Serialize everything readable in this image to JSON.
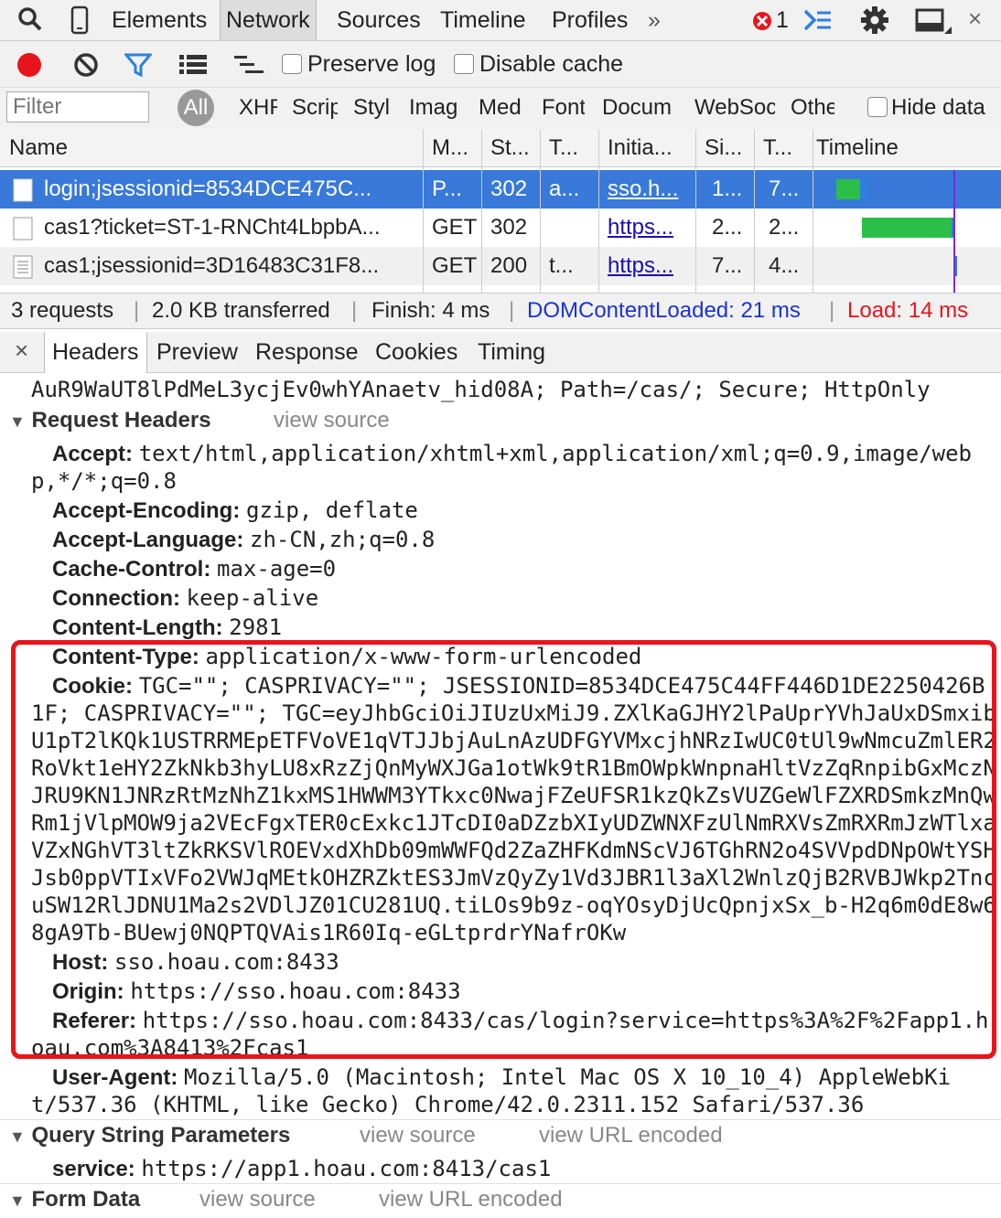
{
  "toolbar": {
    "tabs": [
      "Elements",
      "Network",
      "Sources",
      "Timeline",
      "Profiles"
    ],
    "more": "»",
    "error_count": "1"
  },
  "controls": {
    "preserve_log": "Preserve log",
    "disable_cache": "Disable cache"
  },
  "filter": {
    "placeholder": "Filter",
    "types": [
      "All",
      "XHR",
      "Scrip",
      "Styl",
      "Imag",
      "Med",
      "Font",
      "Docum",
      "WebSoc",
      "Othe"
    ],
    "hide_data": "Hide data"
  },
  "grid": {
    "headers": [
      "Name",
      "M...",
      "St...",
      "T...",
      "Initia...",
      "Si...",
      "T...",
      "Timeline"
    ],
    "rows": [
      {
        "name": "login;jsessionid=8534DCE475C...",
        "method": "P...",
        "status": "302",
        "type": "a...",
        "initiator": "sso.h...",
        "size": "1...",
        "time": "7..."
      },
      {
        "name": "cas1?ticket=ST-1-RNCht4LbpbA...",
        "method": "GET",
        "status": "302",
        "type": "",
        "initiator": "https...",
        "size": "2...",
        "time": "2..."
      },
      {
        "name": "cas1;jsessionid=3D16483C31F8...",
        "method": "GET",
        "status": "200",
        "type": "t...",
        "initiator": "https...",
        "size": "7...",
        "time": "4..."
      }
    ]
  },
  "summary": {
    "requests": "3 requests",
    "transferred": "2.0 KB transferred",
    "finish": "Finish: 4 ms",
    "dcl": "DOMContentLoaded: 21 ms",
    "load": "Load: 14 ms",
    "sep": "|"
  },
  "detail_tabs": [
    "Headers",
    "Preview",
    "Response",
    "Cookies",
    "Timing"
  ],
  "close": "×",
  "headers_panel": {
    "top_line": "AuR9WaUT8lPdMeL3ycjEv0whYAnaetv_hid08A; Path=/cas/; Secure; HttpOnly",
    "request_headers_title": "Request Headers",
    "view_source": "view source",
    "view_url_encoded": "view URL encoded",
    "accept": {
      "key": "Accept:",
      "val1": "text/html,application/xhtml+xml,application/xml;q=0.9,image/web",
      "val2": "p,*/*;q=0.8"
    },
    "accept_encoding": {
      "key": "Accept-Encoding:",
      "val": "gzip, deflate"
    },
    "accept_language": {
      "key": "Accept-Language:",
      "val": "zh-CN,zh;q=0.8"
    },
    "cache_control": {
      "key": "Cache-Control:",
      "val": "max-age=0"
    },
    "connection": {
      "key": "Connection:",
      "val": "keep-alive"
    },
    "content_length": {
      "key": "Content-Length:",
      "val": "2981"
    },
    "content_type": {
      "key": "Content-Type:",
      "val": "application/x-www-form-urlencoded"
    },
    "cookie": {
      "key": "Cookie:",
      "lines": [
        "TGC=\"\"; CASPRIVACY=\"\"; JSESSIONID=8534DCE475C44FF446D1DE2250426B",
        "1F; CASPRIVACY=\"\"; TGC=eyJhbGciOiJIUzUxMiJ9.ZXlKaGJHY2lPaUprYVhJaUxDSmxib",
        "U1pT2lKQk1USTRRMEpETFVoVE1qVTJJbjAuLnAzUDFGYVMxcjhNRzIwUC0tUl9wNmcuZmlER2",
        "RoVkt1eHY2ZkNkb3hyLU8xRzZjQnMyWXJGa1otWk9tR1BmOWpkWnpnaHltVzZqRnpibGxMczN",
        "JRU9KN1JNRzRtMzNhZ1kxMS1HWWM3YTkxc0NwajFZeUFSR1kzQkZsVUZGeWlFZXRDSmkzMnQw",
        "Rm1jVlpMOW9ja2VEcFgxTER0cExkc1JTcDI0aDZzbXIyUDZWNXFzUlNmRXVsZmRXRmJzWTlxa",
        "VZxNGhVT3ltZkRKSVlROEVxdXhDb09mWWFQd2ZaZHFKdmNScVJ6TGhRN2o4SVVpdDNpOWtYSH",
        "Jsb0ppVTIxVFo2VWJqMEtkOHZRZktES3JmVzQyZy1Vd3JBR1l3aXl2WnlzQjB2RVBJWkp2Tnc",
        "uSW12RlJDNU1Ma2s2VDlJZ01CU281UQ.tiLOs9b9z-oqYOsyDjUcQpnjxSx_b-H2q6m0dE8w6",
        "8gA9Tb-BUewj0NQPTQVAis1R60Iq-eGLtprdrYNafrOKw"
      ]
    },
    "host": {
      "key": "Host:",
      "val": "sso.hoau.com:8433"
    },
    "origin": {
      "key": "Origin:",
      "val": "https://sso.hoau.com:8433"
    },
    "referer": {
      "key": "Referer:",
      "val1": "https://sso.hoau.com:8433/cas/login?service=https%3A%2F%2Fapp1.h",
      "val2": "oau.com%3A8413%2Fcas1"
    },
    "user_agent": {
      "key": "User-Agent:",
      "val1": "Mozilla/5.0 (Macintosh; Intel Mac OS X 10_10_4) AppleWebKi",
      "val2": "t/537.36 (KHTML, like Gecko) Chrome/42.0.2311.152 Safari/537.36"
    },
    "query_title": "Query String Parameters",
    "service": {
      "key": "service:",
      "val": "https://app1.hoau.com:8413/cas1"
    },
    "form_title": "Form Data"
  },
  "colors": {
    "selected_row": "#3879d9",
    "highlight_box": "#e8141c",
    "record": "#e8141c",
    "filter_blue": "#2f7fe0",
    "dcl_blue": "#1a33d6",
    "load_red": "#e8141c",
    "timeline_green": "#2bbf48"
  }
}
